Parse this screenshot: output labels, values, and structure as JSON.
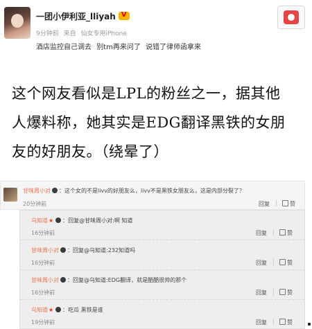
{
  "post": {
    "author": "一团小伊利亚_lliyah",
    "time": "9分钟前",
    "source_prefix": "来自",
    "source": "仙女专用iPhone",
    "text_parts": [
      "酒店监控自己调去",
      "别tm再来问了",
      "说错了律师函拿来"
    ]
  },
  "article": {
    "line1": "这个网友看似是LPL的粉丝之一，据其他",
    "line2": "人爆料称，她其实是EDG翻译黑铁的女朋",
    "line3": "友的好朋友。（绕晕了）"
  },
  "comments": {
    "main": {
      "user": "甘味周小对",
      "text": "：这个女的不是livv的好朋友么，livv不是黑铁女朋友么，这是内部分裂了？",
      "time": "20分钟前",
      "reply_label": "回复",
      "like_label": "赞"
    },
    "replies": [
      {
        "user": "乌知道",
        "text": "：回复@甘味周小对:啊 知道",
        "time": "16分钟前",
        "reply_label": "回复",
        "like_label": "赞"
      },
      {
        "user": "甘味周小对",
        "text": "：回复@乌知道:232知道吗",
        "time": "16分钟前",
        "reply_label": "回复",
        "like_label": "赞"
      },
      {
        "user": "甘味周小对",
        "text": "：回复@乌知道:EDG翻译，就是酷酷很帅的那个",
        "time": "16分钟前",
        "reply_label": "回复",
        "like_label": "赞"
      },
      {
        "user": "乌知道",
        "text": "：吃瓜 黑铁是谁",
        "time": "19分钟前",
        "reply_label": "回复",
        "like_label": "赞"
      }
    ]
  },
  "colors": {
    "username": "#eb7350",
    "timestamp": "#888888",
    "panel_bg": "#eeeeee"
  }
}
